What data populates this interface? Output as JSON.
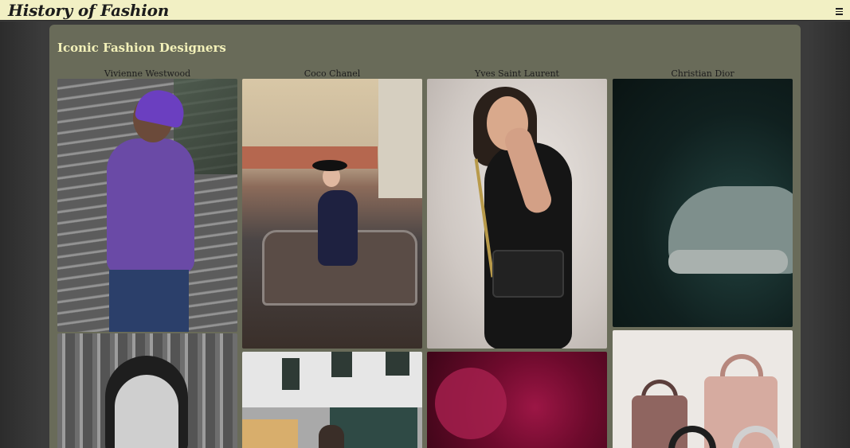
{
  "header": {
    "site_title": "History of Fashion",
    "menu_icon": "hamburger-menu-icon"
  },
  "main": {
    "section_title": "Iconic Fashion Designers",
    "columns": [
      {
        "label": "Vivienne Westwood"
      },
      {
        "label": "Coco Chanel"
      },
      {
        "label": "Yves Saint Laurent"
      },
      {
        "label": "Christian Dior"
      }
    ]
  },
  "colors": {
    "header_bg": "#f2f0c4",
    "panel_bg": "#696b59",
    "section_title": "#f3f1b9",
    "page_bg": "#3a3a3a"
  }
}
